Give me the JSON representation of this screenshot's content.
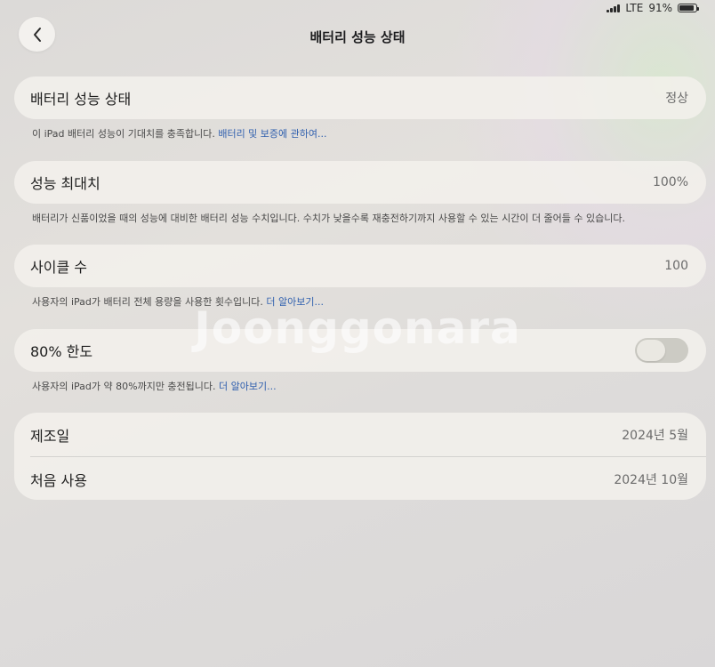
{
  "status_bar": {
    "network": "LTE",
    "battery": "91%",
    "battery_level": 0.91
  },
  "nav": {
    "title": "배터리 성능 상태"
  },
  "health": {
    "label": "배터리 성능 상태",
    "value": "정상",
    "footnote_text": "이 iPad 배터리 성능이 기대치를 충족합니다.",
    "footnote_link": "배터리 및 보증에 관하여..."
  },
  "max_capacity": {
    "label": "성능 최대치",
    "value": "100%",
    "footnote_text": "배터리가 신품이었을 때의 성능에 대비한 배터리 성능 수치입니다. 수치가 낮을수록 재충전하기까지 사용할 수 있는 시간이 더 줄어들 수 있습니다."
  },
  "cycle_count": {
    "label": "사이클 수",
    "value": "100",
    "footnote_text": "사용자의 iPad가 배터리 전체 용량을 사용한 횟수입니다.",
    "footnote_link": "더 알아보기..."
  },
  "limit_80": {
    "label": "80% 한도",
    "enabled": false,
    "footnote_text": "사용자의 iPad가 약 80%까지만 충전됩니다.",
    "footnote_link": "더 알아보기..."
  },
  "dates": [
    {
      "label": "제조일",
      "value": "2024년 5월"
    },
    {
      "label": "처음 사용",
      "value": "2024년 10월"
    }
  ],
  "watermark": "Joonggonara"
}
